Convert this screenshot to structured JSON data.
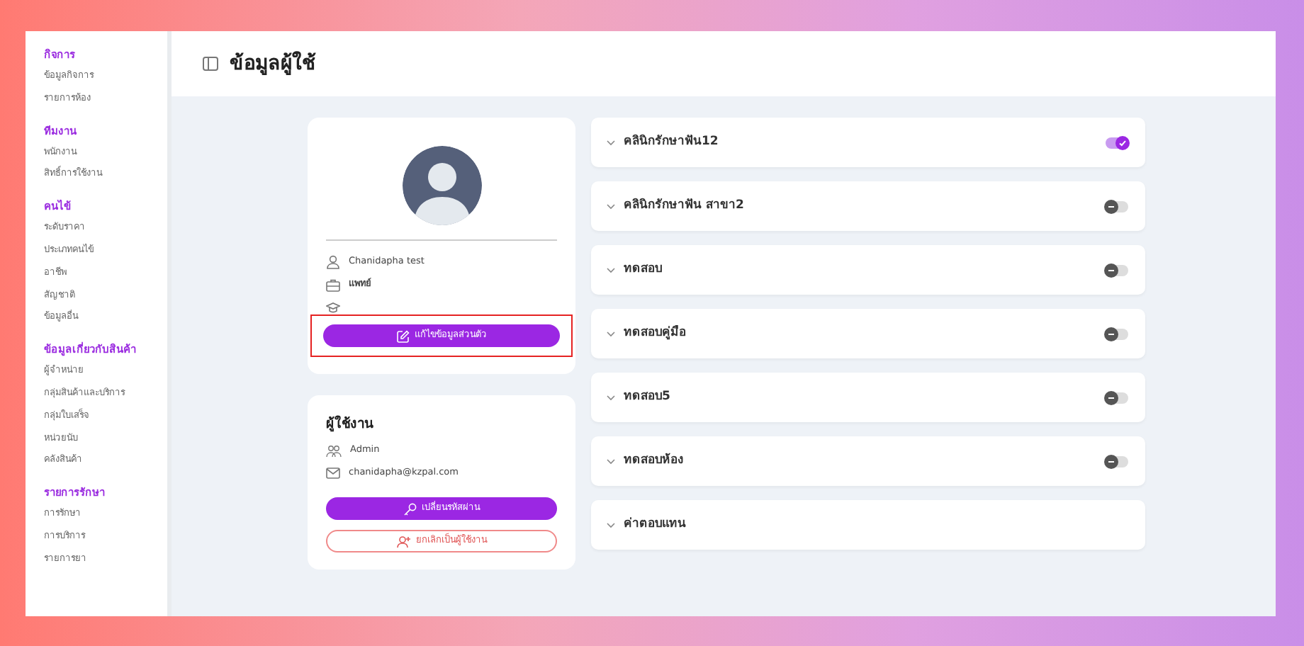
{
  "sidebar": {
    "sections": [
      {
        "title": "กิจการ",
        "items": [
          "ข้อมูลกิจการ",
          "รายการห้อง"
        ]
      },
      {
        "title": "ทีมงาน",
        "items": [
          "พนักงาน",
          "สิทธิ์การใช้งาน"
        ]
      },
      {
        "title": "คนไข้",
        "items": [
          "ระดับราคา",
          "ประเภทคนไข้",
          "อาชีพ",
          "สัญชาติ",
          "ข้อมูลอื่น"
        ]
      },
      {
        "title": "ข้อมูลเกี่ยวกับสินค้า",
        "items": [
          "ผู้จำหน่าย",
          "กลุ่มสินค้าและบริการ",
          "กลุ่มใบเสร็จ",
          "หน่วยนับ",
          "คลังสินค้า"
        ]
      },
      {
        "title": "รายการรักษา",
        "items": [
          "การรักษา",
          "การบริการ",
          "รายการยา"
        ]
      }
    ]
  },
  "header": {
    "title": "ข้อมูลผู้ใช้"
  },
  "profile": {
    "name": "Chanidapha test",
    "profession": "แพทย์",
    "edit_button": {
      "label": "แก้ไขข้อมูลส่วนตัว",
      "highlighted": true
    }
  },
  "account": {
    "title": "ผู้ใช้งาน",
    "role": "Admin",
    "email": "chanidapha@kzpal.com",
    "change_password": "เปลี่ยนรหัสผ่าน",
    "cancel_user": "ยกเลิกเป็นผู้ใช้งาน"
  },
  "clinics": [
    {
      "name": "คลินิกรักษาฟัน12",
      "kind": "toggle",
      "on": true
    },
    {
      "name": "คลินิกรักษาฟัน สาขา2",
      "kind": "toggle",
      "on": false
    },
    {
      "name": "ทดสอบ",
      "kind": "toggle",
      "on": false
    },
    {
      "name": "ทดสอบคู่มือ",
      "kind": "toggle",
      "on": false
    },
    {
      "name": "ทดสอบ5",
      "kind": "toggle",
      "on": false
    },
    {
      "name": "ทดสอบห้อง",
      "kind": "toggle",
      "on": false
    },
    {
      "name": "ค่าตอบแทน",
      "kind": "plain"
    }
  ]
}
